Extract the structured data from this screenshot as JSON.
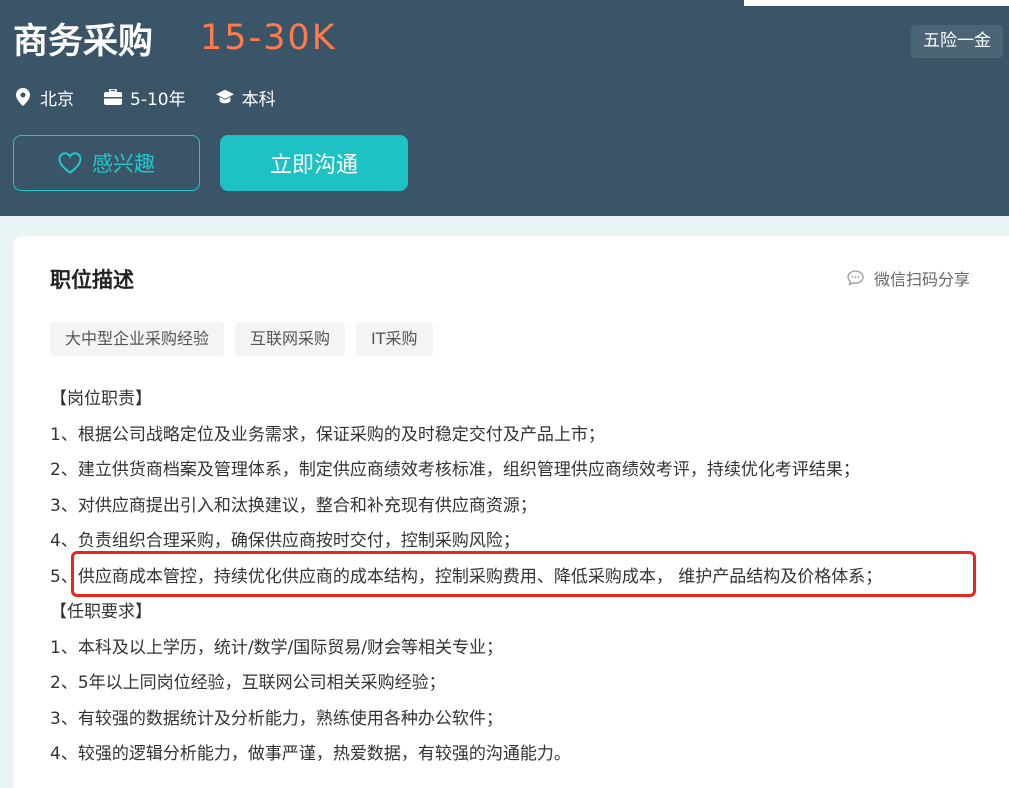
{
  "job": {
    "title": "商务采购",
    "salary": "15-30K",
    "benefit": "五险一金",
    "location": "北京",
    "experience": "5-10年",
    "education": "本科"
  },
  "actions": {
    "interest_label": "感兴趣",
    "chat_label": "立即沟通"
  },
  "description": {
    "section_title": "职位描述",
    "share_label": "微信扫码分享",
    "tags": [
      "大中型企业采购经验",
      "互联网采购",
      "IT采购"
    ],
    "lines": [
      "【岗位职责】",
      "1、根据公司战略定位及业务需求，保证采购的及时稳定交付及产品上市；",
      "2、建立供货商档案及管理体系，制定供应商绩效考核标准，组织管理供应商绩效考评，持续优化考评结果；",
      "3、对供应商提出引入和汰换建议，整合和补充现有供应商资源；",
      "4、负责组织合理采购，确保供应商按时交付，控制采购风险；",
      "5、供应商成本管控，持续优化供应商的成本结构，控制采购费用、降低采购成本， 维护产品结构及价格体系；",
      "【任职要求】",
      "1、本科及以上学历，统计/数学/国际贸易/财会等相关专业；",
      "2、5年以上同岗位经验，互联网公司相关采购经验；",
      "3、有较强的数据统计及分析能力，熟练使用各种办公软件；",
      "4、较强的逻辑分析能力，做事严谨，热爱数据，有较强的沟通能力。"
    ]
  },
  "icons": {
    "location": "location-pin-icon",
    "experience": "briefcase-icon",
    "education": "graduation-cap-icon",
    "interest": "heart-outline-icon",
    "share": "chat-bubble-icon"
  },
  "colors": {
    "header_bg": "#3b5568",
    "salary": "#ff7a4d",
    "accent": "#1fc2c4",
    "highlight_border": "#e8261f"
  }
}
